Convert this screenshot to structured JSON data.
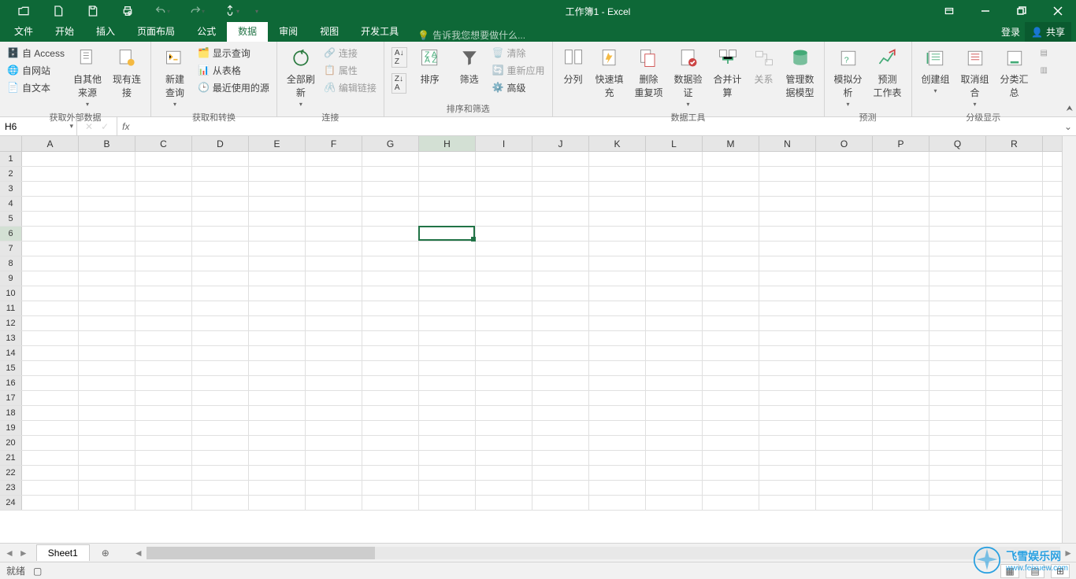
{
  "title": "工作簿1 - Excel",
  "qat": {
    "open": "打开",
    "new": "新建",
    "save": "保存",
    "print": "打印预览",
    "undo": "撤销",
    "redo": "重做",
    "touch": "触摸/鼠标模式"
  },
  "tabs": {
    "file": "文件",
    "home": "开始",
    "insert": "插入",
    "pagelayout": "页面布局",
    "formulas": "公式",
    "data": "数据",
    "review": "审阅",
    "view": "视图",
    "developer": "开发工具",
    "tellme": "告诉我您想要做什么...",
    "signin": "登录",
    "share": "共享"
  },
  "ribbon": {
    "external": {
      "label": "获取外部数据",
      "access": "自 Access",
      "web": "自网站",
      "text": "自文本",
      "other": "自其他来源",
      "existing": "现有连接"
    },
    "transform": {
      "label": "获取和转换",
      "newquery": "新建\n查询",
      "showq": "显示查询",
      "fromtable": "从表格",
      "recent": "最近使用的源"
    },
    "connections": {
      "label": "连接",
      "refresh": "全部刷新",
      "conns": "连接",
      "props": "属性",
      "editlinks": "编辑链接"
    },
    "sortfilter": {
      "label": "排序和筛选",
      "sortaz": "升序",
      "sortza": "降序",
      "sort": "排序",
      "filter": "筛选",
      "clear": "清除",
      "reapply": "重新应用",
      "advanced": "高级"
    },
    "datatools": {
      "label": "数据工具",
      "t2c": "分列",
      "flash": "快速填充",
      "dedup": "删除\n重复项",
      "validate": "数据验\n证",
      "consolidate": "合并计算",
      "rel": "关系",
      "model": "管理数\n据模型"
    },
    "forecast": {
      "label": "预测",
      "whatif": "模拟分析",
      "forecast": "预测\n工作表"
    },
    "outline": {
      "label": "分级显示",
      "group": "创建组",
      "ungroup": "取消组合",
      "subtotal": "分类汇总"
    }
  },
  "namebox": "H6",
  "columns": [
    "A",
    "B",
    "C",
    "D",
    "E",
    "F",
    "G",
    "H",
    "I",
    "J",
    "K",
    "L",
    "M",
    "N",
    "O",
    "P",
    "Q",
    "R"
  ],
  "rows": [
    1,
    2,
    3,
    4,
    5,
    6,
    7,
    8,
    9,
    10,
    11,
    12,
    13,
    14,
    15,
    16,
    17,
    18,
    19,
    20,
    21,
    22,
    23,
    24
  ],
  "selCol": "H",
  "selRow": 6,
  "sheet": "Sheet1",
  "status": {
    "ready": "就绪"
  },
  "watermark": {
    "brand": "飞雪娱乐网",
    "url": "www.feixuew.com"
  }
}
